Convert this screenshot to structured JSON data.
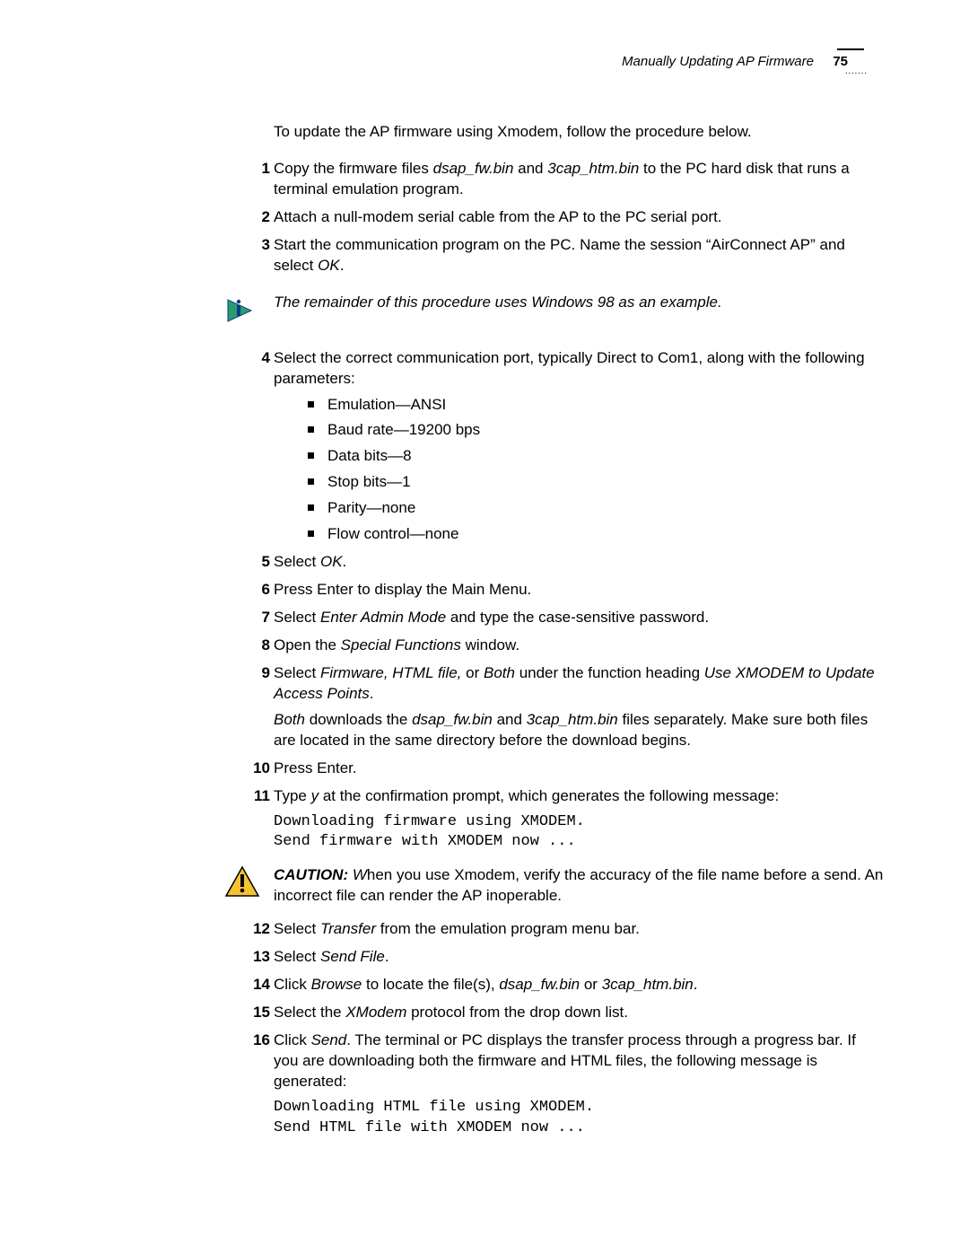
{
  "header": {
    "title": "Manually Updating AP Firmware",
    "page_number": "75"
  },
  "intro": "To update the AP firmware using Xmodem, follow the procedure below.",
  "steps_1_3": [
    {
      "num": "1",
      "pre": "Copy the firmware files ",
      "i1": "dsap_fw.bin",
      "mid": " and ",
      "i2": "3cap_htm.bin",
      "post": " to the PC hard disk that runs a terminal emulation program."
    },
    {
      "num": "2",
      "text": "Attach a null-modem serial cable from the AP to the PC serial port."
    },
    {
      "num": "3",
      "pre": "Start the communication program on the PC. Name the session “AirConnect AP” and select ",
      "i1": "OK",
      "post": "."
    }
  ],
  "note1": "The remainder of this procedure uses Windows 98 as an example.",
  "step4": {
    "num": "4",
    "text": "Select the correct communication port, typically Direct to Com1, along with the following parameters:",
    "bullets": [
      "Emulation—ANSI",
      "Baud rate—19200 bps",
      "Data bits—8",
      "Stop bits—1",
      "Parity—none",
      "Flow control—none"
    ]
  },
  "steps_5_11": [
    {
      "num": "5",
      "pre": "Select ",
      "i1": "OK",
      "post": "."
    },
    {
      "num": "6",
      "text": "Press Enter to display the Main Menu."
    },
    {
      "num": "7",
      "pre": "Select ",
      "i1": "Enter Admin Mode",
      "post": " and type the case-sensitive password."
    },
    {
      "num": "8",
      "pre": "Open the ",
      "i1": "Special Functions",
      "post": " window."
    },
    {
      "num": "9",
      "pre": "Select ",
      "i1": "Firmware, HTML file,",
      "mid": " or ",
      "i2": "Both",
      "mid2": " under the function heading ",
      "i3": "Use XMODEM to Update Access Points",
      "post": ".",
      "sub_i1": "Both",
      "sub_mid1": " downloads the ",
      "sub_i2": "dsap_fw.bin",
      "sub_mid2": " and ",
      "sub_i3": "3cap_htm.bin",
      "sub_post": " files separately. Make sure both files are located in the same directory before the download begins."
    },
    {
      "num": "10",
      "text": "Press Enter."
    },
    {
      "num": "11",
      "pre": "Type ",
      "i1": "y",
      "post": " at the confirmation prompt, which generates the following message:"
    }
  ],
  "code1_l1": "Downloading firmware using XMODEM.",
  "code1_l2": "Send firmware with XMODEM now ...",
  "caution": {
    "label": "CAUTION: ",
    "text_i": "W",
    "text": "hen you use Xmodem, verify the accuracy of the file name before a send. An incorrect file can render the AP inoperable."
  },
  "steps_12_16": [
    {
      "num": "12",
      "pre": "Select ",
      "i1": "Transfer",
      "post": " from the emulation program menu bar."
    },
    {
      "num": "13",
      "pre": "Select ",
      "i1": "Send File",
      "post": "."
    },
    {
      "num": "14",
      "pre": "Click ",
      "i1": "Browse",
      "mid": " to locate the file(s), ",
      "i2": "dsap_fw.bin",
      "mid2": " or ",
      "i3": "3cap_htm.bin",
      "post": "."
    },
    {
      "num": "15",
      "pre": "Select the ",
      "i1": "XModem",
      "post": " protocol from the drop down list."
    },
    {
      "num": "16",
      "pre": "Click ",
      "i1": "Send",
      "post": ". The terminal or PC displays the transfer process through a progress bar. If you are downloading both the firmware and HTML files, the following message is generated:"
    }
  ],
  "code2_l1": "Downloading HTML file using XMODEM.",
  "code2_l2": "Send HTML file with XMODEM now ..."
}
